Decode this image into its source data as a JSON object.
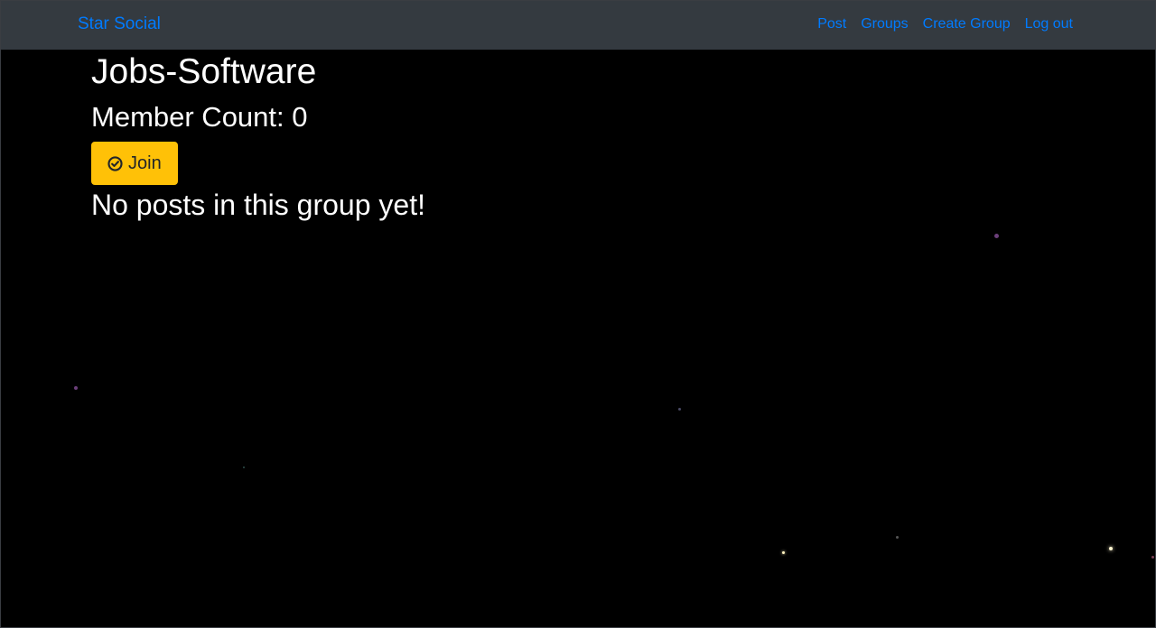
{
  "navbar": {
    "brand": "Star Social",
    "links": {
      "post": "Post",
      "groups": "Groups",
      "create_group": "Create Group",
      "log_out": "Log out"
    }
  },
  "group": {
    "name": "Jobs-Software",
    "member_count": "Member Count: 0",
    "join_label": "Join",
    "empty_message": "No posts in this group yet!"
  },
  "colors": {
    "navbar_bg": "#343a40",
    "link": "#007bff",
    "join_button": "#ffc107",
    "page_bg": "#000000"
  }
}
